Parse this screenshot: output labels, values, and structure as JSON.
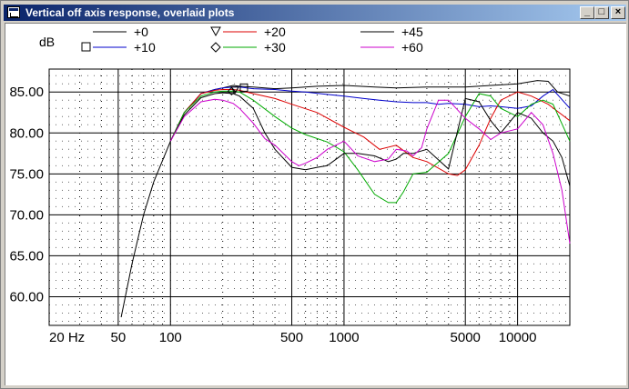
{
  "window": {
    "title": "Vertical off axis response, overlaid plots",
    "icon": "app-window-icon",
    "buttons": {
      "minimize": "_",
      "maximize": "□",
      "close": "×"
    }
  },
  "chart_data": {
    "type": "line",
    "title": "",
    "ylabel": "dB",
    "xlabel": "",
    "xscale": "log",
    "xlim": [
      20,
      20000
    ],
    "ylim": [
      56.5,
      87.8
    ],
    "grid": true,
    "legend_position": "top",
    "x_tick_labels": [
      {
        "x": 20,
        "label": "20 Hz"
      },
      {
        "x": 50,
        "label": "50"
      },
      {
        "x": 100,
        "label": "100"
      },
      {
        "x": 500,
        "label": "500"
      },
      {
        "x": 1000,
        "label": "1000"
      },
      {
        "x": 5000,
        "label": "5000"
      },
      {
        "x": 10000,
        "label": "10000"
      }
    ],
    "y_ticks": [
      60,
      65,
      70,
      75,
      80,
      85
    ],
    "y_tick_labels": [
      "60.00",
      "65.00",
      "70.00",
      "75.00",
      "80.00",
      "85.00"
    ],
    "series": [
      {
        "name": "+0",
        "color": "#000000",
        "marker": "",
        "x": [
          52,
          60,
          70,
          80,
          100,
          120,
          150,
          180,
          200,
          230,
          250,
          300,
          400,
          500,
          700,
          1000,
          1500,
          2000,
          3000,
          5000,
          7000,
          10000,
          13000,
          15000,
          17000,
          20000
        ],
        "y": [
          57.5,
          64,
          70,
          74,
          79,
          82.5,
          84.8,
          85.3,
          85.5,
          85.8,
          85.7,
          85.6,
          85.4,
          85.5,
          85.7,
          85.8,
          85.6,
          85.5,
          85.6,
          85.6,
          85.8,
          86,
          86.4,
          86.3,
          85,
          84.5
        ]
      },
      {
        "name": "+10",
        "color": "#0000cc",
        "marker": "square",
        "x": [
          100,
          120,
          150,
          180,
          200,
          230,
          250,
          300,
          400,
          500,
          600,
          800,
          1000,
          1300,
          1600,
          2000,
          2500,
          3000,
          3500,
          4000,
          5000,
          6000,
          7000,
          8000,
          10000,
          12000,
          14000,
          16000,
          20000
        ],
        "y": [
          79,
          82.5,
          84.8,
          85.3,
          85.5,
          85.6,
          85.6,
          85.4,
          85.3,
          85.1,
          85,
          84.7,
          84.5,
          84.2,
          84,
          83.8,
          83.7,
          83.7,
          83.5,
          83.6,
          83.5,
          83.2,
          83.3,
          83.2,
          83,
          83.3,
          84.5,
          85.3,
          83
        ]
      },
      {
        "name": "+20",
        "color": "#dd0000",
        "marker": "triangle",
        "x": [
          100,
          120,
          150,
          180,
          200,
          230,
          250,
          300,
          400,
          500,
          700,
          1000,
          1300,
          1600,
          2000,
          2500,
          3000,
          4000,
          4500,
          5000,
          6000,
          7000,
          8000,
          10000,
          12000,
          15000,
          20000
        ],
        "y": [
          79,
          82.5,
          84.8,
          85.2,
          85.3,
          85.3,
          85.2,
          84.8,
          84.2,
          83.5,
          82.5,
          80.7,
          79.5,
          78,
          78.5,
          77,
          76.5,
          75,
          74.8,
          75.5,
          78.5,
          81.8,
          84,
          85,
          84.5,
          83.5,
          81.5
        ]
      },
      {
        "name": "+30",
        "color": "#00aa00",
        "marker": "diamond",
        "x": [
          100,
          120,
          150,
          180,
          200,
          230,
          250,
          300,
          400,
          500,
          600,
          800,
          1000,
          1200,
          1500,
          1800,
          2000,
          2200,
          2500,
          3000,
          4000,
          5000,
          6000,
          7000,
          8000,
          10000,
          12000,
          14000,
          16000,
          20000
        ],
        "y": [
          79,
          82.5,
          84.5,
          85,
          85.1,
          85.1,
          85,
          84,
          82,
          80.6,
          79.8,
          78.9,
          77.7,
          75.5,
          72.5,
          71.5,
          71.5,
          72.8,
          75,
          75.2,
          77.5,
          82,
          84.8,
          84.5,
          83,
          82,
          83.5,
          84,
          83.5,
          79
        ]
      },
      {
        "name": "+45",
        "color": "#000000",
        "marker": "",
        "x": [
          100,
          120,
          150,
          180,
          200,
          230,
          250,
          300,
          350,
          400,
          500,
          600,
          700,
          800,
          1000,
          1200,
          1500,
          1800,
          2000,
          2200,
          2500,
          3000,
          4000,
          5000,
          6000,
          7000,
          8000,
          10000,
          12000,
          14000,
          16000,
          18000,
          20000
        ],
        "y": [
          79,
          82.2,
          84.3,
          84.8,
          84.9,
          84.8,
          84.5,
          83,
          80,
          78,
          75.8,
          75.5,
          75.8,
          76,
          77.5,
          77.5,
          77.2,
          76.5,
          76.8,
          77.5,
          77.5,
          78,
          75.6,
          84.2,
          83.8,
          81.5,
          80,
          82.5,
          81.8,
          80,
          79,
          77,
          73.5
        ]
      },
      {
        "name": "+60",
        "color": "#cc00cc",
        "marker": "",
        "x": [
          100,
          120,
          150,
          180,
          200,
          230,
          250,
          300,
          350,
          400,
          500,
          550,
          600,
          700,
          800,
          1000,
          1200,
          1500,
          1800,
          2000,
          2300,
          2500,
          2800,
          3000,
          3500,
          4000,
          5000,
          6000,
          7000,
          8000,
          10000,
          12000,
          14000,
          16000,
          18000,
          20000
        ],
        "y": [
          79,
          82,
          83.8,
          84.1,
          84,
          83.6,
          83,
          81.2,
          79.3,
          78.5,
          76.5,
          76,
          76.3,
          77,
          78,
          79,
          77.2,
          76.5,
          76.8,
          78,
          77.8,
          77.2,
          78.2,
          80.5,
          84,
          84,
          81.8,
          80.5,
          79.2,
          80,
          80.5,
          82.5,
          81,
          77.5,
          73,
          66.5
        ]
      }
    ]
  }
}
